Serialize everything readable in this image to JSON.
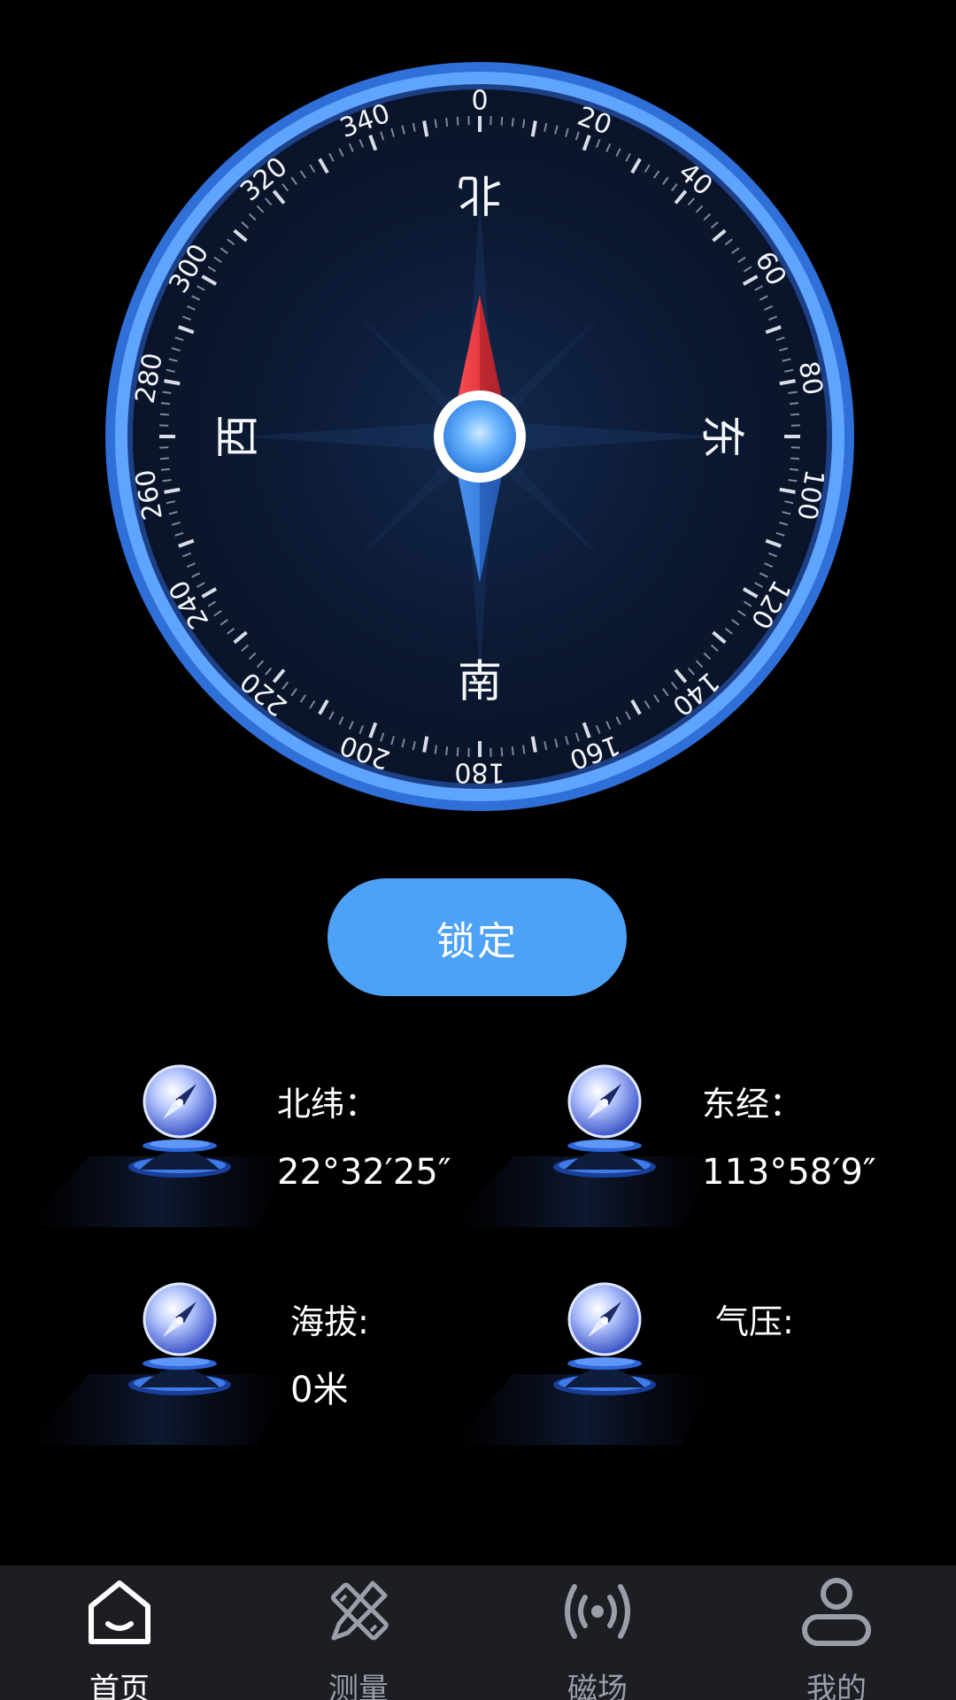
{
  "compass": {
    "bearing_labels": [
      "0",
      "20",
      "40",
      "60",
      "80",
      "100",
      "120",
      "140",
      "160",
      "180",
      "200",
      "220",
      "240",
      "260",
      "280",
      "300",
      "320",
      "340"
    ],
    "directions": {
      "north": "北",
      "east": "东",
      "south": "南",
      "west": "西"
    },
    "heading_degrees": 0
  },
  "lock_button": {
    "label": "锁定"
  },
  "info": {
    "latitude": {
      "label": "北纬：",
      "value": "22°32′25″"
    },
    "longitude": {
      "label": "东经：",
      "value": "113°58′9″"
    },
    "altitude": {
      "label": "海拔:",
      "value": "0米"
    },
    "pressure": {
      "label": "气压:",
      "value": ""
    }
  },
  "bottom_nav": {
    "items": [
      {
        "label": "首页",
        "icon": "home-icon",
        "active": true
      },
      {
        "label": "测量",
        "icon": "ruler-pencil-icon",
        "active": false
      },
      {
        "label": "磁场",
        "icon": "magnetic-signal-icon",
        "active": false
      },
      {
        "label": "我的",
        "icon": "user-icon",
        "active": false
      }
    ]
  },
  "colors": {
    "background": "#000000",
    "dial_ring": "#4a8ff0",
    "dial_face": "#0d1a33",
    "needle_north": "#e8383d",
    "needle_south": "#3a7fdf",
    "button": "#4da2f7",
    "nav_background": "#1c1e24",
    "nav_inactive": "#9a9ea6"
  }
}
